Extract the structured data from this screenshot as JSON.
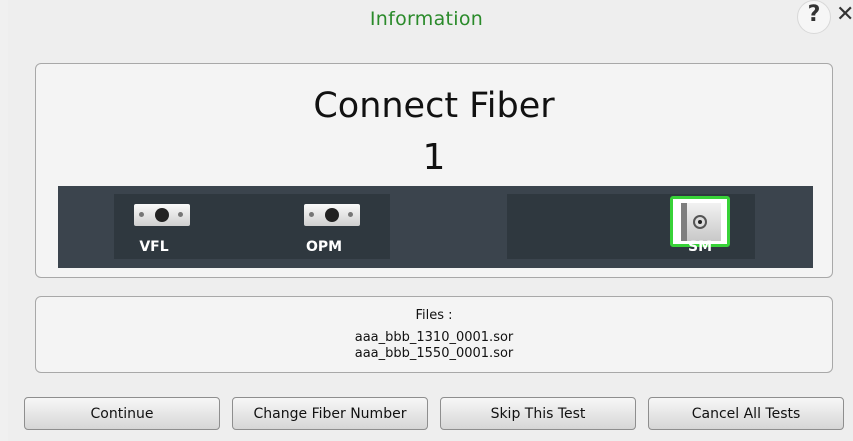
{
  "dialog": {
    "title": "Information",
    "help_glyph": "?",
    "close_glyph": "✕"
  },
  "main": {
    "heading": "Connect Fiber",
    "fiber_number": "1",
    "ports": [
      {
        "label": "VFL",
        "icon": "connector-icon"
      },
      {
        "label": "OPM",
        "icon": "connector-icon"
      },
      {
        "label": "SM",
        "icon": "sm-connector-icon",
        "selected": true
      }
    ],
    "accent_color": "#38d238"
  },
  "files": {
    "label": "Files :",
    "items": [
      "aaa_bbb_1310_0001.sor",
      "aaa_bbb_1550_0001.sor"
    ]
  },
  "buttons": {
    "continue": "Continue",
    "change_fiber": "Change Fiber Number",
    "skip": "Skip This Test",
    "cancel_all": "Cancel All Tests"
  }
}
